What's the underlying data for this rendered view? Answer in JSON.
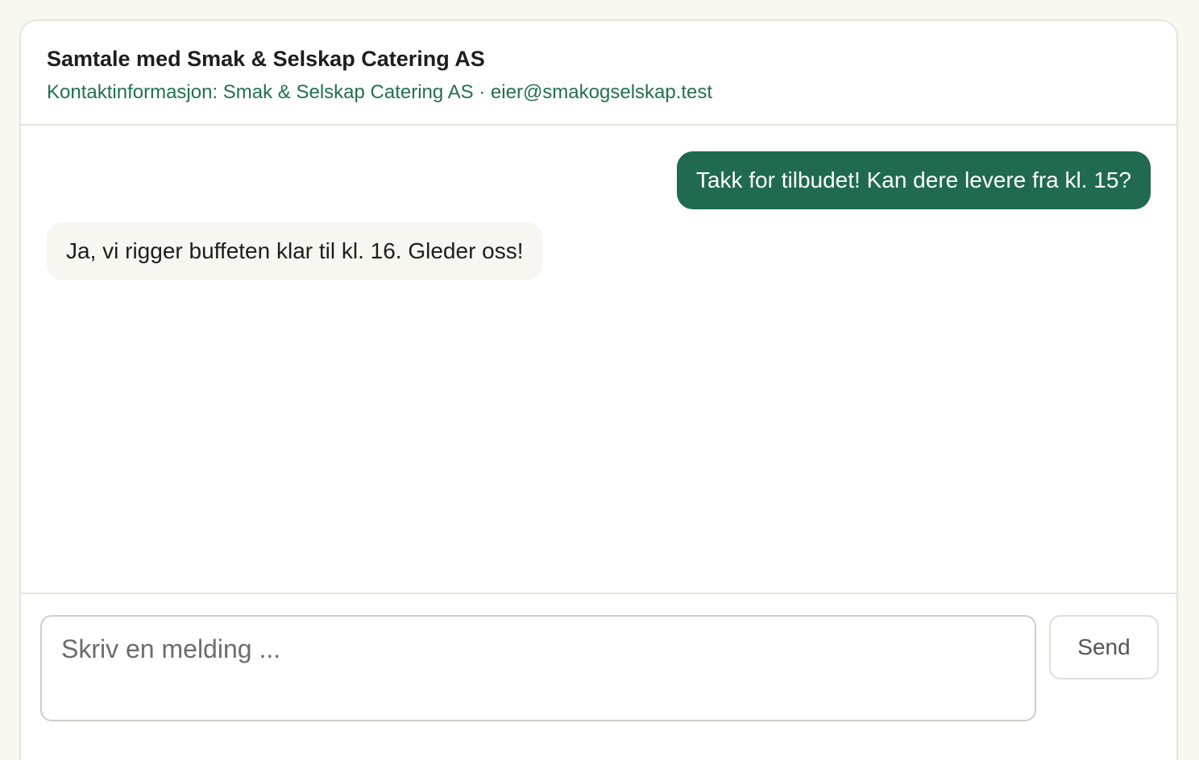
{
  "conversation": {
    "title": "Samtale med Smak & Selskap Catering AS",
    "contact_line": "Kontaktinformasjon: Smak & Selskap Catering AS · eier@smakogselskap.test"
  },
  "messages": [
    {
      "direction": "outgoing",
      "text": "Takk for tilbudet! Kan dere levere fra kl. 15?"
    },
    {
      "direction": "incoming",
      "text": "Ja, vi rigger buffeten klar til kl. 16. Gleder oss!"
    }
  ],
  "composer": {
    "placeholder": "Skriv en melding ...",
    "value": "",
    "send_label": "Send"
  },
  "colors": {
    "accent": "#206a4f",
    "contact_text": "#22704f",
    "incoming_bubble": "#f7f6f1",
    "page_background": "#f8f7f2"
  }
}
